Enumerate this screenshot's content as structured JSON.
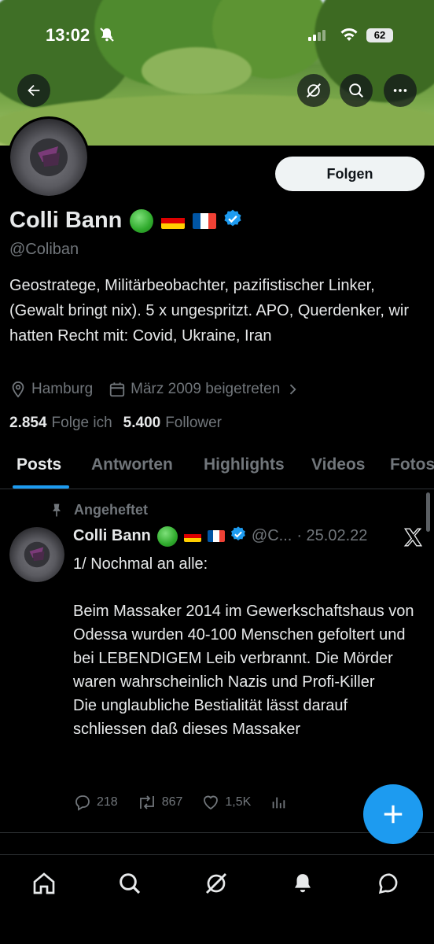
{
  "status_bar": {
    "time": "13:02",
    "battery": "62"
  },
  "profile": {
    "name": "Colli Bann",
    "emoji_badge": "🟢",
    "handle": "@Coliban",
    "follow_label": "Folgen",
    "bio": "Geostratege, Militärbeobachter, pazifistischer Linker, (Gewalt bringt nix). 5 x ungespritzt. APO, Querdenker, wir hatten Recht mit: Covid, Ukraine, Iran",
    "location": "Hamburg",
    "joined": "März 2009 beigetreten",
    "following_count": "2.854",
    "following_label": "Folge ich",
    "followers_count": "5.400",
    "followers_label": "Follower",
    "accent_color": "#1d9bf0"
  },
  "tabs": [
    {
      "label": "Posts"
    },
    {
      "label": "Antworten"
    },
    {
      "label": "Highlights"
    },
    {
      "label": "Videos"
    },
    {
      "label": "Fotos"
    }
  ],
  "pinned_post": {
    "pinned_label": "Angeheftet",
    "author": "Colli Bann",
    "handle_truncated": "@C...",
    "date": "· 25.02.22",
    "text": "1/ Nochmal an alle:\n\nBeim Massaker 2014 im Gewerkschaftshaus von Odessa wurden 40-100 Menschen gefoltert und bei LEBENDIGEM Leib verbrannt. Die Mörder waren wahrscheinlich Nazis und Profi-Killer\nDie unglaubliche Bestialität lässt darauf schliessen daß dieses Massaker",
    "replies": "218",
    "reposts": "867",
    "likes": "1,5K"
  },
  "icons": {
    "back": "arrow-left-icon",
    "grok": "grok-icon",
    "search": "search-icon",
    "more": "more-icon",
    "home": "home-icon",
    "messages": "messages-icon",
    "notifications": "bell-icon",
    "compose": "plus-icon"
  }
}
